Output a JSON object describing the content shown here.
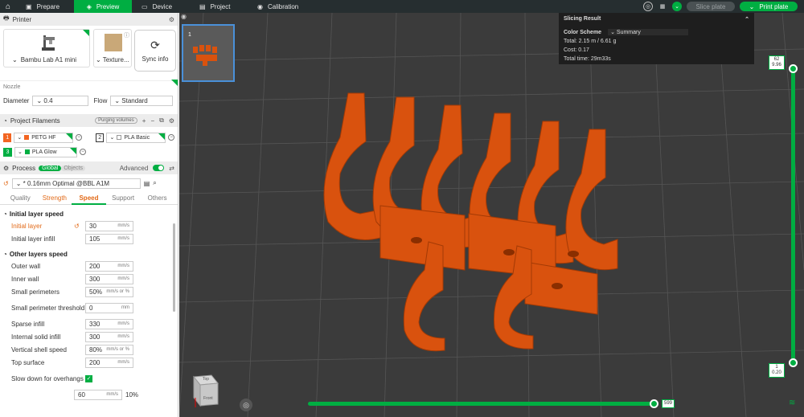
{
  "topbar": {
    "tabs": [
      {
        "label": "Prepare"
      },
      {
        "label": "Preview"
      },
      {
        "label": "Device"
      },
      {
        "label": "Project"
      },
      {
        "label": "Calibration"
      }
    ],
    "slice_plate": "Slice plate",
    "print_plate": "Print plate"
  },
  "printer": {
    "header": "Printer",
    "name": "Bambu Lab A1 mini",
    "plate": "Texture...",
    "sync": "Sync info",
    "nozzle_label": "Nozzle",
    "diameter_label": "Diameter",
    "diameter_value": "0.4",
    "flow_label": "Flow",
    "flow_value": "Standard"
  },
  "filaments": {
    "header": "Project Filaments",
    "purge": "Purging volumes",
    "items": [
      {
        "num": "1",
        "name": "PETG HF",
        "color": "#f26522"
      },
      {
        "num": "2",
        "name": "PLA Basic",
        "color": "#ffffff"
      },
      {
        "num": "3",
        "name": "PLA Glow",
        "color": "#00ae42"
      }
    ]
  },
  "process": {
    "header": "Process",
    "global": "Global",
    "objects": "Objects",
    "advanced": "Advanced",
    "preset": "* 0.16mm Optimal @BBL A1M",
    "tabs": [
      "Quality",
      "Strength",
      "Speed",
      "Support",
      "Others"
    ],
    "initial_group": "Initial layer speed",
    "initial_rows": [
      {
        "label": "Initial layer",
        "value": "30",
        "unit": "mm/s"
      },
      {
        "label": "Initial layer infill",
        "value": "105",
        "unit": "mm/s"
      }
    ],
    "other_group": "Other layers speed",
    "other_rows": [
      {
        "label": "Outer wall",
        "value": "200",
        "unit": "mm/s"
      },
      {
        "label": "Inner wall",
        "value": "300",
        "unit": "mm/s"
      },
      {
        "label": "Small perimeters",
        "value": "50%",
        "unit": "mm/s or %"
      },
      {
        "label": "Small perimeter threshold",
        "value": "0",
        "unit": "mm"
      },
      {
        "label": "Sparse infill",
        "value": "330",
        "unit": "mm/s"
      },
      {
        "label": "Internal solid infill",
        "value": "300",
        "unit": "mm/s"
      },
      {
        "label": "Vertical shell speed",
        "value": "80%",
        "unit": "mm/s or %"
      },
      {
        "label": "Top surface",
        "value": "200",
        "unit": "mm/s"
      },
      {
        "label": "Slow down for overhangs",
        "value": "",
        "unit": ""
      }
    ],
    "last_value": "60",
    "last_unit": "mm/s",
    "last_pct": "10%"
  },
  "preview": {
    "plate_number": "1",
    "slicing_title": "Slicing Result",
    "color_scheme_label": "Color Scheme",
    "color_scheme_value": "Summary",
    "total": "Total:  2.15 m / 6.61 g",
    "cost": "Cost:  0.17",
    "total_time": "Total time:   29m33s",
    "top_layer": "62",
    "top_height": "9.96",
    "bottom_layer": "1",
    "bottom_height": "0.20",
    "move_value": "599",
    "cube_top": "Top",
    "cube_front": "Front"
  }
}
